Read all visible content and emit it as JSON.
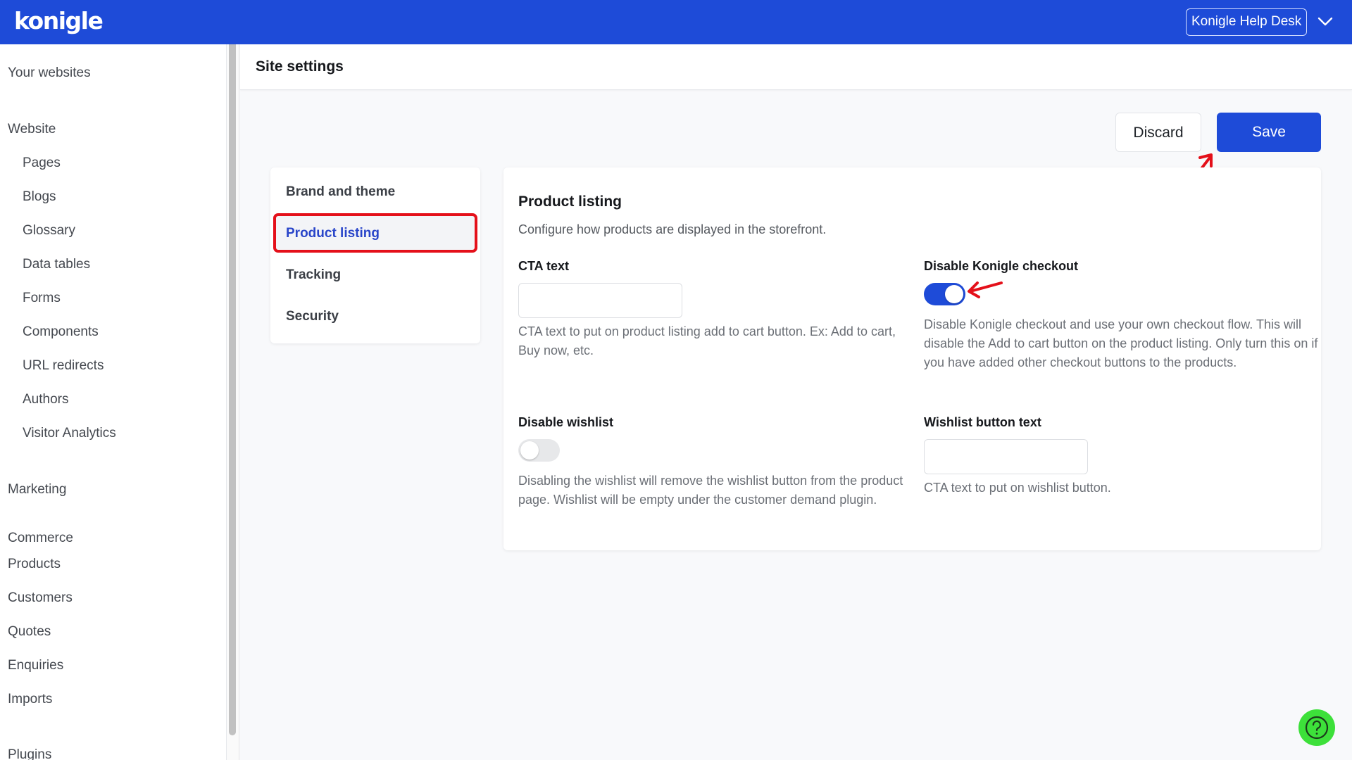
{
  "app": {
    "logo": "konigle",
    "help_desk_label": "Konigle Help Desk",
    "colors": {
      "brand": "#1e4bd8",
      "annotation": "#e4101a",
      "help_fab": "#3de03a"
    }
  },
  "sidebar": {
    "items": [
      {
        "label": "Your websites",
        "level": "top"
      },
      {
        "label": "Website",
        "level": "top"
      },
      {
        "label": "Pages",
        "level": "sub"
      },
      {
        "label": "Blogs",
        "level": "sub"
      },
      {
        "label": "Glossary",
        "level": "sub"
      },
      {
        "label": "Data tables",
        "level": "sub"
      },
      {
        "label": "Forms",
        "level": "sub"
      },
      {
        "label": "Components",
        "level": "sub"
      },
      {
        "label": "URL redirects",
        "level": "sub"
      },
      {
        "label": "Authors",
        "level": "sub"
      },
      {
        "label": "Visitor Analytics",
        "level": "sub"
      },
      {
        "label": "Marketing",
        "level": "top"
      },
      {
        "label": "Commerce",
        "level": "top"
      },
      {
        "label": "Products",
        "level": "top"
      },
      {
        "label": "Customers",
        "level": "top"
      },
      {
        "label": "Quotes",
        "level": "top"
      },
      {
        "label": "Enquiries",
        "level": "top"
      },
      {
        "label": "Imports",
        "level": "top"
      },
      {
        "label": "Plugins",
        "level": "top"
      }
    ]
  },
  "page": {
    "title": "Site settings",
    "discard_label": "Discard",
    "save_label": "Save"
  },
  "settings_nav": {
    "items": [
      {
        "label": "Brand and theme",
        "active": false
      },
      {
        "label": "Product listing",
        "active": true
      },
      {
        "label": "Tracking",
        "active": false
      },
      {
        "label": "Security",
        "active": false
      }
    ]
  },
  "product_listing": {
    "title": "Product listing",
    "subtitle": "Configure how products are displayed in the storefront.",
    "cta_text": {
      "label": "CTA text",
      "value": "",
      "help": "CTA text to put on product listing add to cart button. Ex: Add to cart, Buy now, etc."
    },
    "disable_checkout": {
      "label": "Disable Konigle checkout",
      "enabled": true,
      "help": "Disable Konigle checkout and use your own checkout flow. This will disable the Add to cart button on the product listing. Only turn this on if you have added other checkout buttons to the products."
    },
    "disable_wishlist": {
      "label": "Disable wishlist",
      "enabled": false,
      "help": "Disabling the wishlist will remove the wishlist button from the product page. Wishlist will be empty under the customer demand plugin."
    },
    "wishlist_button_text": {
      "label": "Wishlist button text",
      "value": "",
      "help": "CTA text to put on wishlist button."
    }
  }
}
